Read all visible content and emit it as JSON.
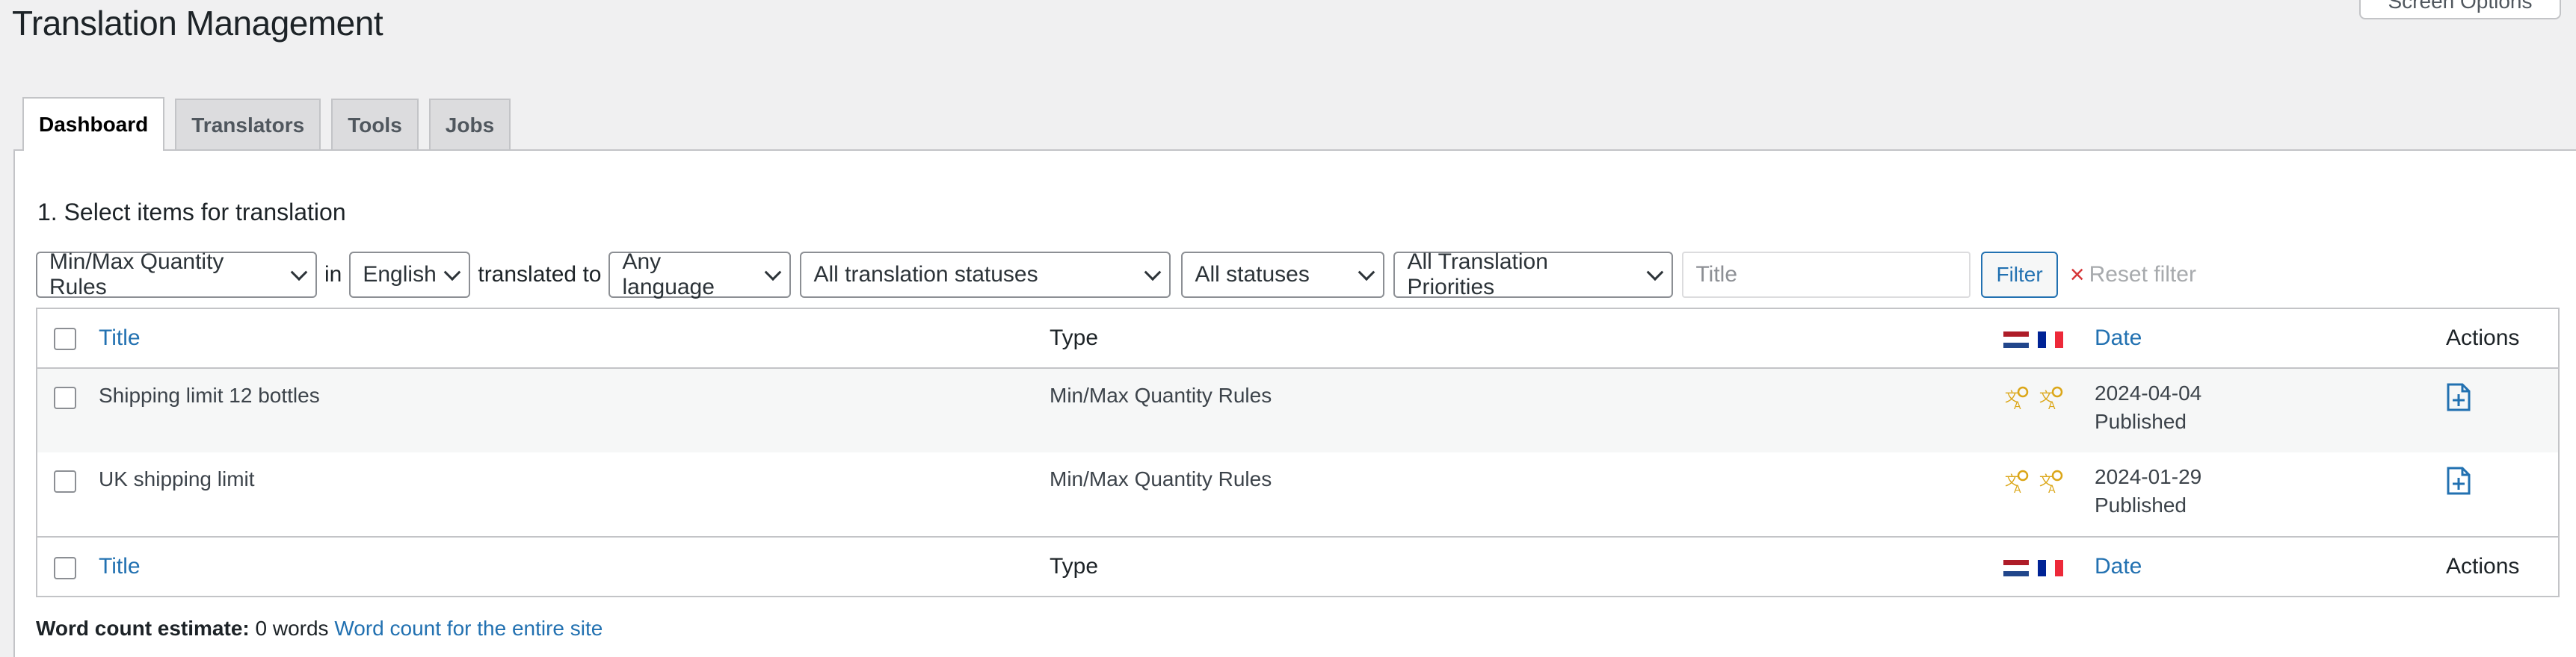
{
  "page": {
    "title": "Translation Management",
    "screen_options": "Screen Options"
  },
  "tabs": [
    {
      "label": "Dashboard",
      "active": true
    },
    {
      "label": "Translators",
      "active": false
    },
    {
      "label": "Tools",
      "active": false
    },
    {
      "label": "Jobs",
      "active": false
    }
  ],
  "section": {
    "title": "1. Select items for translation"
  },
  "filters": {
    "type": "Min/Max Quantity Rules",
    "in_label": "in",
    "source_language": "English",
    "translated_to_label": "translated to",
    "target_language": "Any language",
    "translation_status": "All translation statuses",
    "status": "All statuses",
    "priority": "All Translation Priorities",
    "title_placeholder": "Title",
    "filter_button": "Filter",
    "reset_label": "Reset filter"
  },
  "table": {
    "columns": {
      "title": "Title",
      "type": "Type",
      "date": "Date",
      "actions": "Actions"
    },
    "rows": [
      {
        "title": "Shipping limit 12 bottles",
        "type": "Min/Max Quantity Rules",
        "date": "2024-04-04",
        "status": "Published"
      },
      {
        "title": "UK shipping limit",
        "type": "Min/Max Quantity Rules",
        "date": "2024-01-29",
        "status": "Published"
      }
    ]
  },
  "word_count": {
    "label": "Word count estimate:",
    "value": "0 words",
    "link": "Word count for the entire site"
  },
  "colors": {
    "link": "#2271b1",
    "translation_icon": "#dba617",
    "reset_x": "#d63638"
  },
  "icons": {
    "translation": "translation-needed-icon",
    "add_translation": "add-to-basket-icon"
  }
}
